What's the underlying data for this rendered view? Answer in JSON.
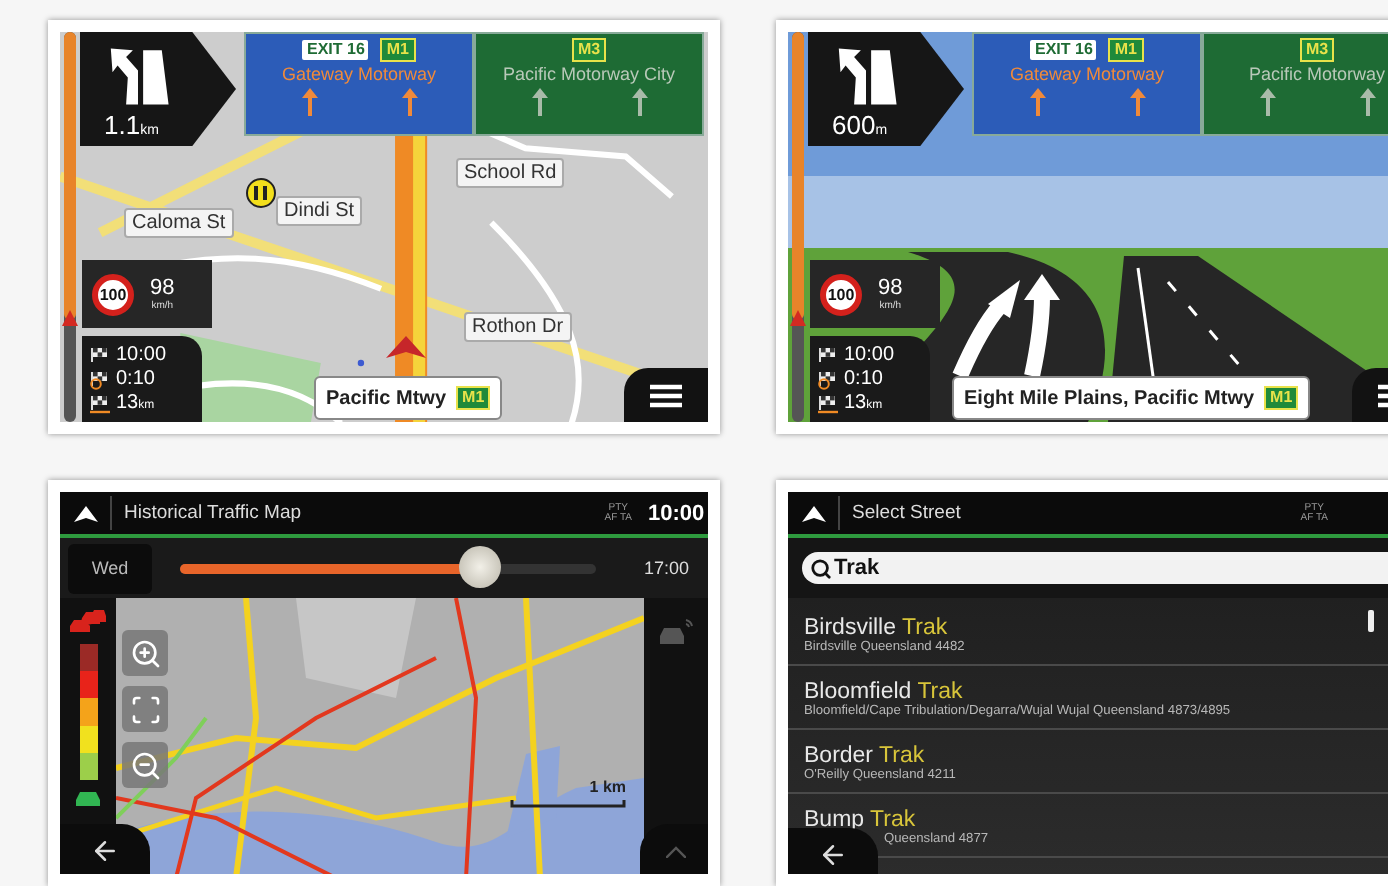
{
  "panels": [
    {
      "kind": "map",
      "route_progress": {
        "level": 0.74
      },
      "maneuver": {
        "distance": "1.1",
        "unit": "km"
      },
      "signs": [
        {
          "exit": "EXIT 16",
          "route": "M1",
          "destination": "Gateway Motorway",
          "color": "#2c5cb8",
          "selected": true
        },
        {
          "route": "M3",
          "destination": "Pacific Motorway  City",
          "color": "#1e6b34",
          "selected": false
        }
      ],
      "street_labels": [
        "School Rd",
        "Dindi St",
        "Caloma St",
        "Rothon Dr"
      ],
      "speed_limit": "100",
      "speed": "98",
      "speed_unit": "km/h",
      "trip": [
        {
          "kind": "arrival",
          "value": "10:00"
        },
        {
          "kind": "remaining_time",
          "value": "0:10"
        },
        {
          "kind": "remaining_distance",
          "value": "13",
          "unit": "km"
        }
      ],
      "street": {
        "name": "Pacific Mtwy",
        "route": "M1"
      }
    },
    {
      "kind": "junction",
      "route_progress": {
        "level": 0.74
      },
      "maneuver": {
        "distance": "600",
        "unit": "m"
      },
      "signs": [
        {
          "exit": "EXIT 16",
          "route": "M1",
          "destination": "Gateway Motorway",
          "color": "#2c5cb8",
          "selected": true
        },
        {
          "route": "M3",
          "destination": "Pacific Motorway",
          "color": "#1e6b34",
          "selected": false
        }
      ],
      "speed_limit": "100",
      "speed": "98",
      "speed_unit": "km/h",
      "trip": [
        {
          "kind": "arrival",
          "value": "10:00"
        },
        {
          "kind": "remaining_time",
          "value": "0:10"
        },
        {
          "kind": "remaining_distance",
          "value": "13",
          "unit": "km"
        }
      ],
      "street": {
        "name": "Eight Mile Plains, Pacific Mtwy",
        "route": "M1"
      }
    },
    {
      "kind": "traffic_map",
      "header": {
        "title": "Historical Traffic Map",
        "radio_top": "PTY",
        "radio_bottom": "AF TA",
        "time": "10:00"
      },
      "day": "Wed",
      "slider": {
        "level": 0.72
      },
      "slider_time": "17:00",
      "scale": "1 km"
    },
    {
      "kind": "street_search",
      "header": {
        "title": "Select Street",
        "radio_top": "PTY",
        "radio_bottom": "AF TA"
      },
      "search": {
        "value": "Trak"
      },
      "results": [
        {
          "name": "Birdsville",
          "match": "Trak",
          "detail": "Birdsville Queensland 4482"
        },
        {
          "name": "Bloomfield",
          "match": "Trak",
          "detail": "Bloomfield/Cape Tribulation/Degarra/Wujal Wujal Queensland 4873/4895"
        },
        {
          "name": "Border",
          "match": "Trak",
          "detail": "O'Reilly Queensland 4211"
        },
        {
          "name": "Bump",
          "match": "Trak",
          "detail": "Queensland 4877"
        }
      ]
    }
  ]
}
